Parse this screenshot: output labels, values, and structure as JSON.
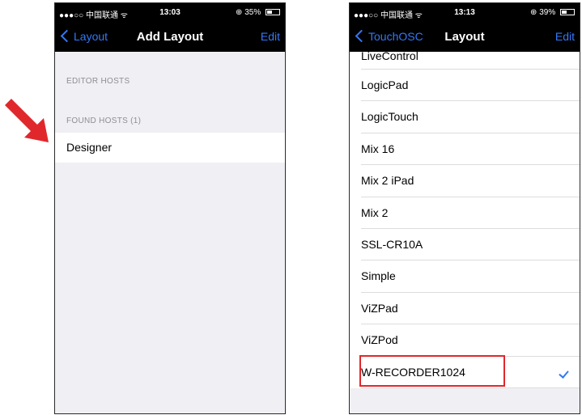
{
  "left_screen": {
    "status": {
      "carrier": "●●●○○ 中国联通 ᯤ",
      "time": "13:03",
      "battery": "35%",
      "battery_level": 0.35
    },
    "nav": {
      "back_label": "Layout",
      "title": "Add Layout",
      "edit_label": "Edit"
    },
    "editor_hosts_header": "EDITOR HOSTS",
    "found_hosts_header": "FOUND HOSTS (1)",
    "host": "Designer"
  },
  "right_screen": {
    "status": {
      "carrier": "●●●○○ 中国联通 ᯤ",
      "time": "13:13",
      "battery": "39%",
      "battery_level": 0.39
    },
    "nav": {
      "back_label": "TouchOSC",
      "title": "Layout",
      "edit_label": "Edit"
    },
    "layouts": [
      "LiveControl",
      "LogicPad",
      "LogicTouch",
      "Mix 16",
      "Mix 2 iPad",
      "Mix 2",
      "SSL-CR10A",
      "Simple",
      "ViZPad",
      "ViZPod",
      "W-RECORDER1024"
    ],
    "selected": "W-RECORDER1024"
  },
  "colors": {
    "accent": "#3478f6",
    "highlight": "#e0282c",
    "arrow": "#e0282c",
    "background": "#efeff4"
  }
}
